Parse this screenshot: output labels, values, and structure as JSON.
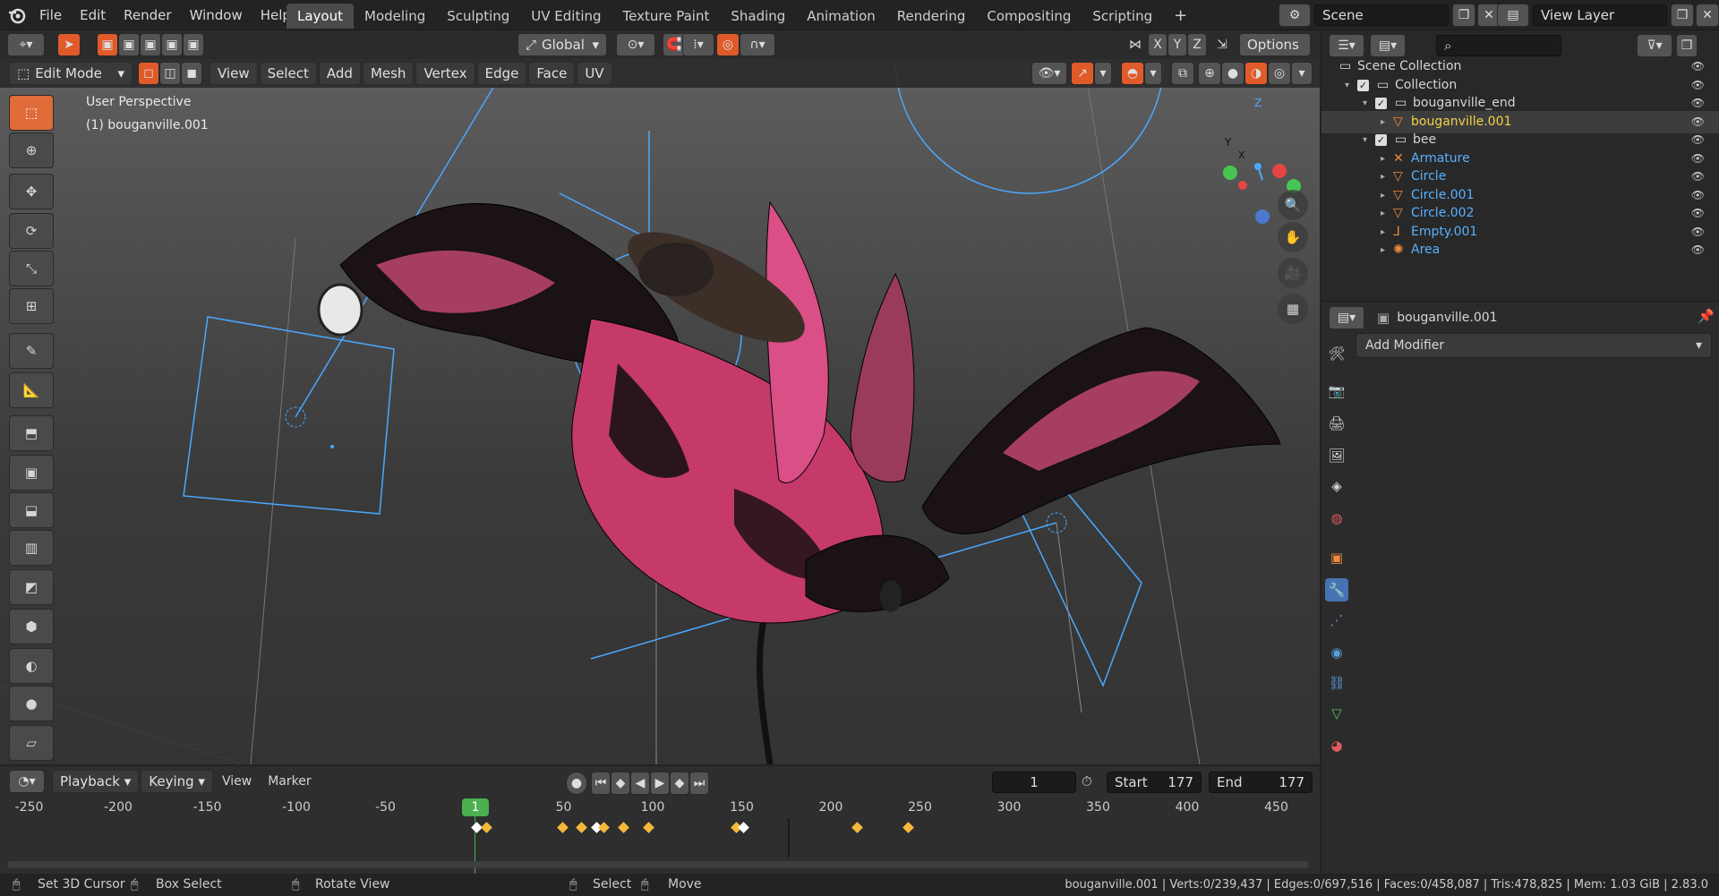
{
  "menu": {
    "items": [
      "File",
      "Edit",
      "Render",
      "Window",
      "Help"
    ],
    "workspaces": [
      "Layout",
      "Modeling",
      "Sculpting",
      "UV Editing",
      "Texture Paint",
      "Shading",
      "Animation",
      "Rendering",
      "Compositing",
      "Scripting"
    ],
    "active_workspace": "Layout",
    "scene_label": "Scene",
    "view_layer_label": "View Layer"
  },
  "tool_header": {
    "transform_orientation": "Global",
    "axes": [
      "X",
      "Y",
      "Z"
    ],
    "options_label": "Options"
  },
  "viewport_header": {
    "mode": "Edit Mode",
    "menus": [
      "View",
      "Select",
      "Add",
      "Mesh",
      "Vertex",
      "Edge",
      "Face",
      "UV"
    ]
  },
  "viewport": {
    "view_name": "User Perspective",
    "object_name": "(1) bouganville.001",
    "gizmo_axes": [
      "Z",
      "Y",
      "X"
    ]
  },
  "outliner": {
    "rows": [
      {
        "label": "Scene Collection",
        "indent": 0,
        "color": "#d6d6d6",
        "icon": "scene-collection-icon"
      },
      {
        "label": "Collection",
        "indent": 1,
        "color": "#d6d6d6",
        "icon": "collection-icon"
      },
      {
        "label": "bouganville_end",
        "indent": 2,
        "color": "#d6d6d6",
        "icon": "collection-icon"
      },
      {
        "label": "bouganville.001",
        "indent": 3,
        "color": "#f5d14a",
        "icon": "mesh-icon",
        "selected": true
      },
      {
        "label": "bee",
        "indent": 2,
        "color": "#d6d6d6",
        "icon": "collection-icon"
      },
      {
        "label": "Armature",
        "indent": 3,
        "color": "#5ab0ff",
        "icon": "armature-icon"
      },
      {
        "label": "Circle",
        "indent": 3,
        "color": "#5ab0ff",
        "icon": "mesh-icon"
      },
      {
        "label": "Circle.001",
        "indent": 3,
        "color": "#5ab0ff",
        "icon": "mesh-icon"
      },
      {
        "label": "Circle.002",
        "indent": 3,
        "color": "#5ab0ff",
        "icon": "mesh-icon"
      },
      {
        "label": "Empty.001",
        "indent": 3,
        "color": "#5ab0ff",
        "icon": "empty-icon"
      },
      {
        "label": "Area",
        "indent": 3,
        "color": "#5ab0ff",
        "icon": "light-icon"
      }
    ]
  },
  "properties": {
    "object_name": "bouganville.001",
    "add_modifier_label": "Add Modifier"
  },
  "timeline": {
    "menus": [
      "Playback",
      "Keying",
      "View",
      "Marker"
    ],
    "current_frame": "1",
    "start_label": "Start",
    "start_value": "177",
    "end_label": "End",
    "end_value": "177",
    "ruler_ticks": [
      "-250",
      "-200",
      "-150",
      "-100",
      "-50",
      "50",
      "100",
      "150",
      "200",
      "250",
      "300",
      "350",
      "400",
      "450"
    ],
    "playhead_label": "1"
  },
  "statusbar": {
    "hints": [
      "Set 3D Cursor",
      "Box Select",
      "Rotate View",
      "Select",
      "Move"
    ],
    "stats": "bouganville.001 | Verts:0/239,437 | Edges:0/697,516 | Faces:0/458,087 | Tris:478,825 | Mem: 1.03 GiB | 2.83.0"
  },
  "colors": {
    "accent": "#e06c3a",
    "selection_blue": "#4aa8ff",
    "active_object": "#f5d14a",
    "keyframe": "#f5b93a",
    "playhead": "#4caf50"
  }
}
